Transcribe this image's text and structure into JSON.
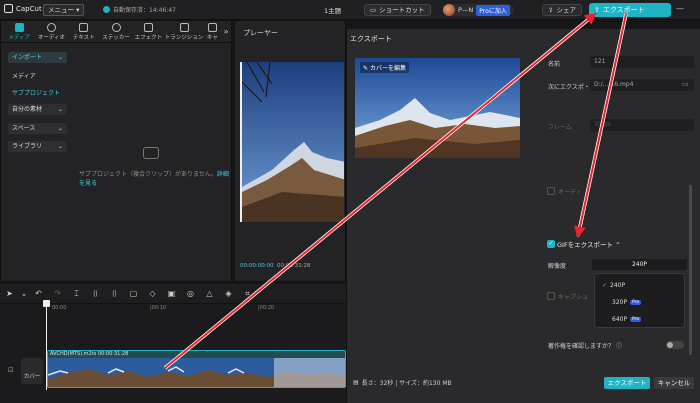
{
  "topbar": {
    "app_name": "CapCut",
    "menu_label": "メニュー",
    "autosave": "自動保存済：14:46:47",
    "project_title": "1主題",
    "shortcut_label": "ショートカット",
    "user_name": "P—N",
    "pro_label": "Proに加入",
    "share_label": "シェア",
    "export_label": "エクスポート"
  },
  "media": {
    "tabs": [
      {
        "label": "メディア",
        "icon": "media-icon"
      },
      {
        "label": "オーディオ",
        "icon": "audio-icon"
      },
      {
        "label": "テキスト",
        "icon": "text-icon"
      },
      {
        "label": "ステッカー",
        "icon": "sticker-icon"
      },
      {
        "label": "エフェクト",
        "icon": "effect-icon"
      },
      {
        "label": "トランジション",
        "icon": "transition-icon"
      },
      {
        "label": "キャ",
        "icon": "caption-icon"
      }
    ],
    "sidebar": {
      "import": "インポート",
      "media": "メディア",
      "subproject": "サブプロジェクト",
      "own_material": "自分の素材",
      "space": "スペース",
      "library": "ライブラリ"
    },
    "empty_text": "サブプロジェクト（複合クリップ）がありません。",
    "empty_link": "詳細を見る"
  },
  "player": {
    "title": "プレーヤー",
    "current_time": "00:00:00:00",
    "total_time": "00:00:31:28"
  },
  "timeline": {
    "ruler": [
      "00:00",
      "|00:10",
      "|00:20"
    ],
    "cover_label": "カバー",
    "clip_label": "AVCHD(MTS).m2ts  00:00:31:28"
  },
  "export_dialog": {
    "title": "エクスポート",
    "cover_edit": "カバーを編集",
    "name_label": "名前",
    "name_value": "121",
    "path_label": "次にエクスポ・",
    "path_value": "D:/.../16.mp4",
    "framerate_label": "フレーム",
    "framerate_value": "30fps",
    "audio_label": "オーディ",
    "gif_label": "GIFをエクスポート",
    "resolution_label": "解像度",
    "resolution_value": "240P",
    "resolution_options": [
      {
        "label": "240P",
        "selected": true,
        "pro": false
      },
      {
        "label": "320P",
        "selected": false,
        "pro": true
      },
      {
        "label": "640P",
        "selected": false,
        "pro": true
      }
    ],
    "pro_badge": "Pro",
    "caption_label": "キャプショ",
    "copyright_label": "著作権を確認しますか？",
    "summary": "長さ：32秒 | サイズ：約130 MB",
    "export_button": "エクスポート",
    "cancel_button": "キャンセル"
  },
  "colors": {
    "accent": "#1fb4c4",
    "arrow": "#e8242c",
    "pro": "#2f5fd8"
  }
}
